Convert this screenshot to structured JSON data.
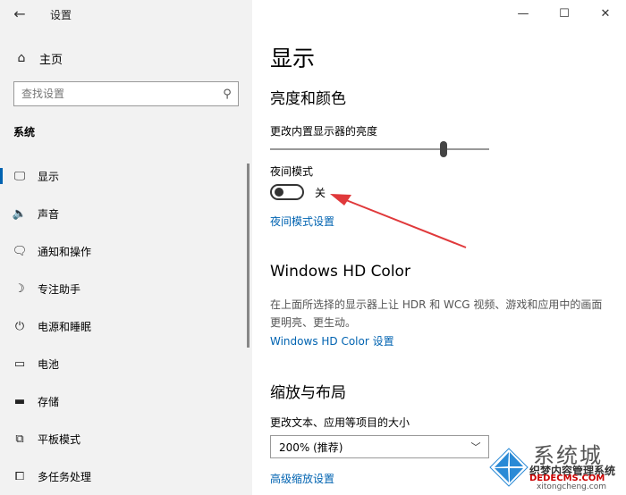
{
  "window": {
    "title": "设置",
    "controls": {
      "minimize": "—",
      "maximize": "☐",
      "close": "✕"
    }
  },
  "sidebar": {
    "home_label": "主页",
    "search_placeholder": "查找设置",
    "section_label": "系统",
    "items": [
      {
        "label": "显示",
        "icon": "monitor-icon",
        "glyph": "🖵",
        "active": true
      },
      {
        "label": "声音",
        "icon": "speaker-icon",
        "glyph": "🔈"
      },
      {
        "label": "通知和操作",
        "icon": "notification-icon",
        "glyph": "🗨"
      },
      {
        "label": "专注助手",
        "icon": "moon-icon",
        "glyph": "☽"
      },
      {
        "label": "电源和睡眠",
        "icon": "power-icon",
        "glyph": "⏻"
      },
      {
        "label": "电池",
        "icon": "battery-icon",
        "glyph": "▭"
      },
      {
        "label": "存储",
        "icon": "storage-icon",
        "glyph": "▬"
      },
      {
        "label": "平板模式",
        "icon": "tablet-mode-icon",
        "glyph": "⧉"
      },
      {
        "label": "多任务处理",
        "icon": "multitasking-icon",
        "glyph": "⧠"
      }
    ]
  },
  "main": {
    "page_title": "显示",
    "brightness_heading": "亮度和颜色",
    "brightness_label": "更改内置显示器的亮度",
    "brightness_level_percent": 79,
    "night_mode_label": "夜间模式",
    "night_mode_state": "关",
    "night_mode_settings_link": "夜间模式设置",
    "hdr_heading": "Windows HD Color",
    "hdr_description": "在上面所选择的显示器上让 HDR 和 WCG 视频、游戏和应用中的画面更明亮、更生动。",
    "hdr_link": "Windows HD Color 设置",
    "scale_heading": "缩放与布局",
    "scale_label": "更改文本、应用等项目的大小",
    "scale_value": "200% (推荐)",
    "advanced_scale_link": "高级缩放设置"
  },
  "annotation": {
    "arrow_color": "#e0393b"
  },
  "watermark": {
    "line1": "系统城",
    "line2": "织梦内容管理系统",
    "line3": "DEDECMS.COM",
    "line4": "xitongcheng.com"
  }
}
